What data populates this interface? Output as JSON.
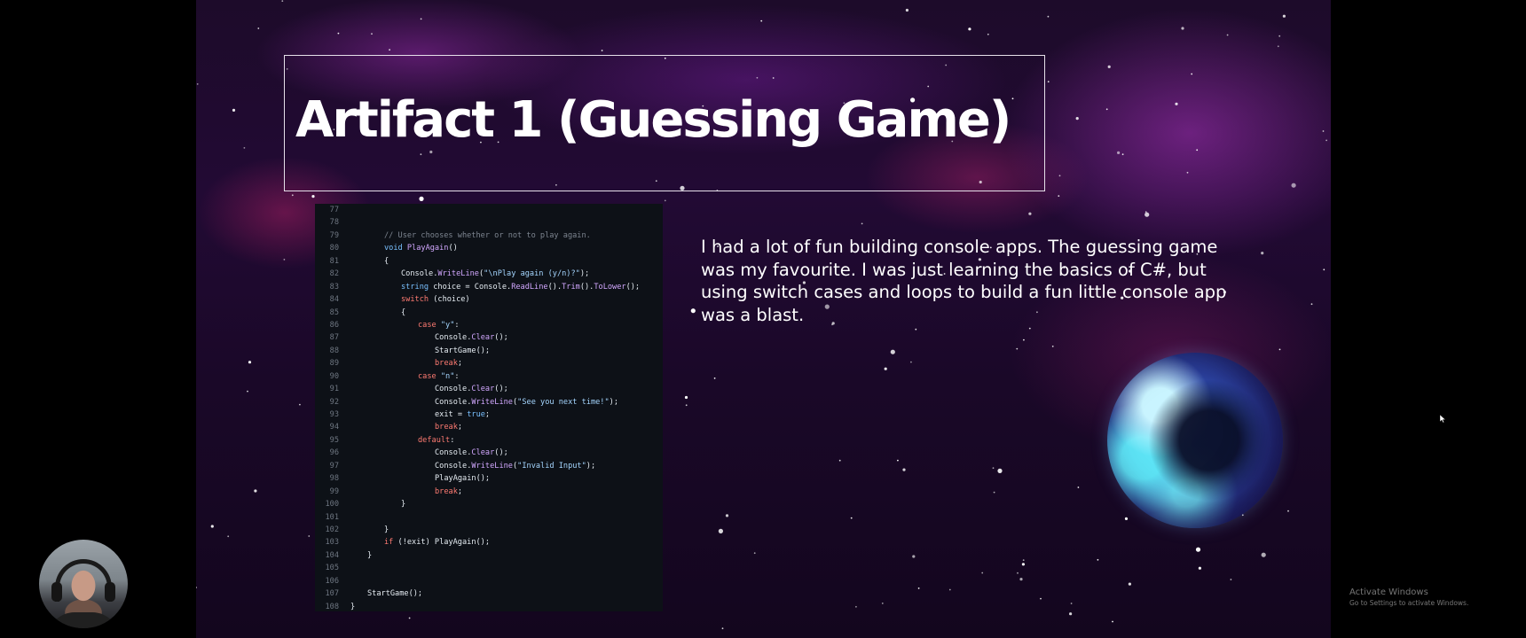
{
  "slide": {
    "title": "Artifact 1 (Guessing Game)",
    "description": "I had a lot of fun building console apps. The guessing game was my favourite. I was just learning the basics of C#, but using switch cases and loops to build a fun little console app was a blast."
  },
  "code": {
    "lines": [
      {
        "n": "77",
        "indent": 0,
        "parts": []
      },
      {
        "n": "78",
        "indent": 0,
        "parts": []
      },
      {
        "n": "79",
        "indent": 2,
        "parts": [
          [
            "com",
            "// User chooses whether or not to play again."
          ]
        ]
      },
      {
        "n": "80",
        "indent": 2,
        "parts": [
          [
            "kw",
            "void "
          ],
          [
            "fn",
            "PlayAgain"
          ],
          [
            "tx",
            "()"
          ]
        ]
      },
      {
        "n": "81",
        "indent": 2,
        "parts": [
          [
            "tx",
            "{"
          ]
        ]
      },
      {
        "n": "82",
        "indent": 3,
        "parts": [
          [
            "tx",
            "Console."
          ],
          [
            "fn",
            "WriteLine"
          ],
          [
            "tx",
            "("
          ],
          [
            "str",
            "\"\\nPlay again (y/n)?\""
          ],
          [
            "tx",
            ");"
          ]
        ]
      },
      {
        "n": "83",
        "indent": 3,
        "parts": [
          [
            "kw",
            "string "
          ],
          [
            "tx",
            "choice = Console."
          ],
          [
            "fn",
            "ReadLine"
          ],
          [
            "tx",
            "()."
          ],
          [
            "fn",
            "Trim"
          ],
          [
            "tx",
            "()."
          ],
          [
            "fn",
            "ToLower"
          ],
          [
            "tx",
            "();"
          ]
        ]
      },
      {
        "n": "84",
        "indent": 3,
        "parts": [
          [
            "red",
            "switch "
          ],
          [
            "tx",
            "(choice)"
          ]
        ]
      },
      {
        "n": "85",
        "indent": 3,
        "parts": [
          [
            "tx",
            "{"
          ]
        ]
      },
      {
        "n": "86",
        "indent": 4,
        "parts": [
          [
            "red",
            "case "
          ],
          [
            "str",
            "\"y\""
          ],
          [
            "tx",
            ":"
          ]
        ]
      },
      {
        "n": "87",
        "indent": 5,
        "parts": [
          [
            "tx",
            "Console."
          ],
          [
            "fn",
            "Clear"
          ],
          [
            "tx",
            "();"
          ]
        ]
      },
      {
        "n": "88",
        "indent": 5,
        "parts": [
          [
            "tx",
            "StartGame();"
          ]
        ]
      },
      {
        "n": "89",
        "indent": 5,
        "parts": [
          [
            "red",
            "break"
          ],
          [
            "tx",
            ";"
          ]
        ]
      },
      {
        "n": "90",
        "indent": 4,
        "parts": [
          [
            "red",
            "case "
          ],
          [
            "str",
            "\"n\""
          ],
          [
            "tx",
            ":"
          ]
        ]
      },
      {
        "n": "91",
        "indent": 5,
        "parts": [
          [
            "tx",
            "Console."
          ],
          [
            "fn",
            "Clear"
          ],
          [
            "tx",
            "();"
          ]
        ]
      },
      {
        "n": "92",
        "indent": 5,
        "parts": [
          [
            "tx",
            "Console."
          ],
          [
            "fn",
            "WriteLine"
          ],
          [
            "tx",
            "("
          ],
          [
            "str",
            "\"See you next time!\""
          ],
          [
            "tx",
            ");"
          ]
        ]
      },
      {
        "n": "93",
        "indent": 5,
        "parts": [
          [
            "tx",
            "exit = "
          ],
          [
            "kw",
            "true"
          ],
          [
            "tx",
            ";"
          ]
        ]
      },
      {
        "n": "94",
        "indent": 5,
        "parts": [
          [
            "red",
            "break"
          ],
          [
            "tx",
            ";"
          ]
        ]
      },
      {
        "n": "95",
        "indent": 4,
        "parts": [
          [
            "red",
            "default"
          ],
          [
            "tx",
            ":"
          ]
        ]
      },
      {
        "n": "96",
        "indent": 5,
        "parts": [
          [
            "tx",
            "Console."
          ],
          [
            "fn",
            "Clear"
          ],
          [
            "tx",
            "();"
          ]
        ]
      },
      {
        "n": "97",
        "indent": 5,
        "parts": [
          [
            "tx",
            "Console."
          ],
          [
            "fn",
            "WriteLine"
          ],
          [
            "tx",
            "("
          ],
          [
            "str",
            "\"Invalid Input\""
          ],
          [
            "tx",
            ");"
          ]
        ]
      },
      {
        "n": "98",
        "indent": 5,
        "parts": [
          [
            "tx",
            "PlayAgain();"
          ]
        ]
      },
      {
        "n": "99",
        "indent": 5,
        "parts": [
          [
            "red",
            "break"
          ],
          [
            "tx",
            ";"
          ]
        ]
      },
      {
        "n": "100",
        "indent": 3,
        "parts": [
          [
            "tx",
            "}"
          ]
        ]
      },
      {
        "n": "101",
        "indent": 0,
        "parts": []
      },
      {
        "n": "102",
        "indent": 2,
        "parts": [
          [
            "tx",
            "}"
          ]
        ]
      },
      {
        "n": "103",
        "indent": 2,
        "parts": [
          [
            "red",
            "if "
          ],
          [
            "tx",
            "(!exit) PlayAgain();"
          ]
        ]
      },
      {
        "n": "104",
        "indent": 1,
        "parts": [
          [
            "tx",
            "}"
          ]
        ]
      },
      {
        "n": "105",
        "indent": 0,
        "parts": []
      },
      {
        "n": "106",
        "indent": 0,
        "parts": []
      },
      {
        "n": "107",
        "indent": 1,
        "parts": [
          [
            "tx",
            "StartGame();"
          ]
        ]
      },
      {
        "n": "108",
        "indent": 0,
        "parts": [
          [
            "tx",
            "}"
          ]
        ]
      }
    ],
    "colors": {
      "com": "#7d8590",
      "kw": "#79c0ff",
      "fn": "#d2a8ff",
      "str": "#a5d6ff",
      "red": "#ff7b72",
      "tx": "#e6edf3"
    }
  },
  "watermark": {
    "title": "Activate Windows",
    "subtitle": "Go to Settings to activate Windows."
  },
  "icons": {
    "cursor": "mouse-cursor-icon",
    "planet": "planet-image",
    "webcam": "webcam-avatar"
  }
}
